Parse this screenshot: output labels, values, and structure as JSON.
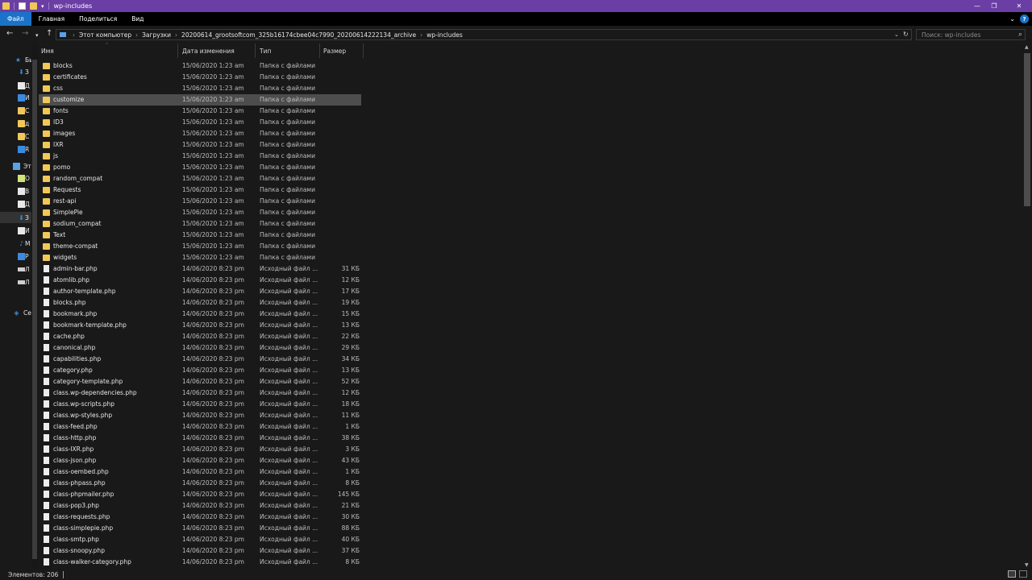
{
  "window": {
    "title": "wp-includes",
    "controls": {
      "minimize": "—",
      "maximize": "❐",
      "close": "✕"
    }
  },
  "ribbon": {
    "tabs": [
      "Файл",
      "Главная",
      "Поделиться",
      "Вид"
    ],
    "active_tab": "Файл",
    "expand_glyph": "⌄",
    "help_glyph": "?"
  },
  "address_bar": {
    "breadcrumb": [
      "Этот компьютер",
      "Загрузки",
      "20200614_grootsoftcom_325b16174cbee04c7990_20200614222134_archive",
      "wp-includes"
    ],
    "search_placeholder": "Поиск: wp-includes"
  },
  "nav_pane": {
    "items": [
      {
        "label": "Бы",
        "icon": "star-icon"
      },
      {
        "label": "З",
        "icon": "download-icon"
      },
      {
        "label": "Д",
        "icon": "document-icon"
      },
      {
        "label": "И",
        "icon": "picture-icon"
      },
      {
        "label": "С",
        "icon": "folder-icon"
      },
      {
        "label": "д",
        "icon": "folder-icon"
      },
      {
        "label": "С",
        "icon": "folder-icon"
      },
      {
        "label": "R",
        "icon": "monitor-icon"
      },
      {
        "label": "Эт",
        "icon": "computer-icon"
      },
      {
        "label": "О",
        "icon": "cube-icon"
      },
      {
        "label": "В",
        "icon": "video-icon"
      },
      {
        "label": "Д",
        "icon": "document-icon"
      },
      {
        "label": "З",
        "icon": "download-icon"
      },
      {
        "label": "И",
        "icon": "picture-icon"
      },
      {
        "label": "М",
        "icon": "music-icon"
      },
      {
        "label": "Р",
        "icon": "desktop-icon"
      },
      {
        "label": "Л",
        "icon": "drive-icon"
      },
      {
        "label": "Л",
        "icon": "drive-icon"
      },
      {
        "label": "Се",
        "icon": "network-icon"
      }
    ]
  },
  "columns": {
    "name": "Имя",
    "date": "Дата изменения",
    "type": "Тип",
    "size": "Размер"
  },
  "files": [
    {
      "name": "blocks",
      "date": "15/06/2020 1:23 am",
      "type": "Папка с файлами",
      "size": "",
      "kind": "folder"
    },
    {
      "name": "certificates",
      "date": "15/06/2020 1:23 am",
      "type": "Папка с файлами",
      "size": "",
      "kind": "folder"
    },
    {
      "name": "css",
      "date": "15/06/2020 1:23 am",
      "type": "Папка с файлами",
      "size": "",
      "kind": "folder"
    },
    {
      "name": "customize",
      "date": "15/06/2020 1:23 am",
      "type": "Папка с файлами",
      "size": "",
      "kind": "folder",
      "hover": true
    },
    {
      "name": "fonts",
      "date": "15/06/2020 1:23 am",
      "type": "Папка с файлами",
      "size": "",
      "kind": "folder"
    },
    {
      "name": "ID3",
      "date": "15/06/2020 1:23 am",
      "type": "Папка с файлами",
      "size": "",
      "kind": "folder"
    },
    {
      "name": "images",
      "date": "15/06/2020 1:23 am",
      "type": "Папка с файлами",
      "size": "",
      "kind": "folder"
    },
    {
      "name": "IXR",
      "date": "15/06/2020 1:23 am",
      "type": "Папка с файлами",
      "size": "",
      "kind": "folder"
    },
    {
      "name": "js",
      "date": "15/06/2020 1:23 am",
      "type": "Папка с файлами",
      "size": "",
      "kind": "folder"
    },
    {
      "name": "pomo",
      "date": "15/06/2020 1:23 am",
      "type": "Папка с файлами",
      "size": "",
      "kind": "folder"
    },
    {
      "name": "random_compat",
      "date": "15/06/2020 1:23 am",
      "type": "Папка с файлами",
      "size": "",
      "kind": "folder"
    },
    {
      "name": "Requests",
      "date": "15/06/2020 1:23 am",
      "type": "Папка с файлами",
      "size": "",
      "kind": "folder"
    },
    {
      "name": "rest-api",
      "date": "15/06/2020 1:23 am",
      "type": "Папка с файлами",
      "size": "",
      "kind": "folder"
    },
    {
      "name": "SimplePie",
      "date": "15/06/2020 1:23 am",
      "type": "Папка с файлами",
      "size": "",
      "kind": "folder"
    },
    {
      "name": "sodium_compat",
      "date": "15/06/2020 1:23 am",
      "type": "Папка с файлами",
      "size": "",
      "kind": "folder"
    },
    {
      "name": "Text",
      "date": "15/06/2020 1:23 am",
      "type": "Папка с файлами",
      "size": "",
      "kind": "folder"
    },
    {
      "name": "theme-compat",
      "date": "15/06/2020 1:23 am",
      "type": "Папка с файлами",
      "size": "",
      "kind": "folder"
    },
    {
      "name": "widgets",
      "date": "15/06/2020 1:23 am",
      "type": "Папка с файлами",
      "size": "",
      "kind": "folder"
    },
    {
      "name": "admin-bar.php",
      "date": "14/06/2020 8:23 pm",
      "type": "Исходный файл ...",
      "size": "31 КБ",
      "kind": "php"
    },
    {
      "name": "atomlib.php",
      "date": "14/06/2020 8:23 pm",
      "type": "Исходный файл ...",
      "size": "12 КБ",
      "kind": "php"
    },
    {
      "name": "author-template.php",
      "date": "14/06/2020 8:23 pm",
      "type": "Исходный файл ...",
      "size": "17 КБ",
      "kind": "php"
    },
    {
      "name": "blocks.php",
      "date": "14/06/2020 8:23 pm",
      "type": "Исходный файл ...",
      "size": "19 КБ",
      "kind": "php"
    },
    {
      "name": "bookmark.php",
      "date": "14/06/2020 8:23 pm",
      "type": "Исходный файл ...",
      "size": "15 КБ",
      "kind": "php"
    },
    {
      "name": "bookmark-template.php",
      "date": "14/06/2020 8:23 pm",
      "type": "Исходный файл ...",
      "size": "13 КБ",
      "kind": "php"
    },
    {
      "name": "cache.php",
      "date": "14/06/2020 8:23 pm",
      "type": "Исходный файл ...",
      "size": "22 КБ",
      "kind": "php"
    },
    {
      "name": "canonical.php",
      "date": "14/06/2020 8:23 pm",
      "type": "Исходный файл ...",
      "size": "29 КБ",
      "kind": "php"
    },
    {
      "name": "capabilities.php",
      "date": "14/06/2020 8:23 pm",
      "type": "Исходный файл ...",
      "size": "34 КБ",
      "kind": "php"
    },
    {
      "name": "category.php",
      "date": "14/06/2020 8:23 pm",
      "type": "Исходный файл ...",
      "size": "13 КБ",
      "kind": "php"
    },
    {
      "name": "category-template.php",
      "date": "14/06/2020 8:23 pm",
      "type": "Исходный файл ...",
      "size": "52 КБ",
      "kind": "php"
    },
    {
      "name": "class.wp-dependencies.php",
      "date": "14/06/2020 8:23 pm",
      "type": "Исходный файл ...",
      "size": "12 КБ",
      "kind": "php"
    },
    {
      "name": "class.wp-scripts.php",
      "date": "14/06/2020 8:23 pm",
      "type": "Исходный файл ...",
      "size": "18 КБ",
      "kind": "php"
    },
    {
      "name": "class.wp-styles.php",
      "date": "14/06/2020 8:23 pm",
      "type": "Исходный файл ...",
      "size": "11 КБ",
      "kind": "php"
    },
    {
      "name": "class-feed.php",
      "date": "14/06/2020 8:23 pm",
      "type": "Исходный файл ...",
      "size": "1 КБ",
      "kind": "php"
    },
    {
      "name": "class-http.php",
      "date": "14/06/2020 8:23 pm",
      "type": "Исходный файл ...",
      "size": "38 КБ",
      "kind": "php"
    },
    {
      "name": "class-IXR.php",
      "date": "14/06/2020 8:23 pm",
      "type": "Исходный файл ...",
      "size": "3 КБ",
      "kind": "php"
    },
    {
      "name": "class-json.php",
      "date": "14/06/2020 8:23 pm",
      "type": "Исходный файл ...",
      "size": "43 КБ",
      "kind": "php"
    },
    {
      "name": "class-oembed.php",
      "date": "14/06/2020 8:23 pm",
      "type": "Исходный файл ...",
      "size": "1 КБ",
      "kind": "php"
    },
    {
      "name": "class-phpass.php",
      "date": "14/06/2020 8:23 pm",
      "type": "Исходный файл ...",
      "size": "8 КБ",
      "kind": "php"
    },
    {
      "name": "class-phpmailer.php",
      "date": "14/06/2020 8:23 pm",
      "type": "Исходный файл ...",
      "size": "145 КБ",
      "kind": "php"
    },
    {
      "name": "class-pop3.php",
      "date": "14/06/2020 8:23 pm",
      "type": "Исходный файл ...",
      "size": "21 КБ",
      "kind": "php"
    },
    {
      "name": "class-requests.php",
      "date": "14/06/2020 8:23 pm",
      "type": "Исходный файл ...",
      "size": "30 КБ",
      "kind": "php"
    },
    {
      "name": "class-simplepie.php",
      "date": "14/06/2020 8:23 pm",
      "type": "Исходный файл ...",
      "size": "88 КБ",
      "kind": "php"
    },
    {
      "name": "class-smtp.php",
      "date": "14/06/2020 8:23 pm",
      "type": "Исходный файл ...",
      "size": "40 КБ",
      "kind": "php"
    },
    {
      "name": "class-snoopy.php",
      "date": "14/06/2020 8:23 pm",
      "type": "Исходный файл ...",
      "size": "37 КБ",
      "kind": "php"
    },
    {
      "name": "class-walker-category.php",
      "date": "14/06/2020 8:23 pm",
      "type": "Исходный файл ...",
      "size": "8 КБ",
      "kind": "php"
    }
  ],
  "status": {
    "items_label": "Элементов: 206"
  },
  "colors": {
    "titlebar": "#6a3ea5",
    "accent": "#1a73c8",
    "folder": "#f1c857",
    "background": "#191919"
  }
}
